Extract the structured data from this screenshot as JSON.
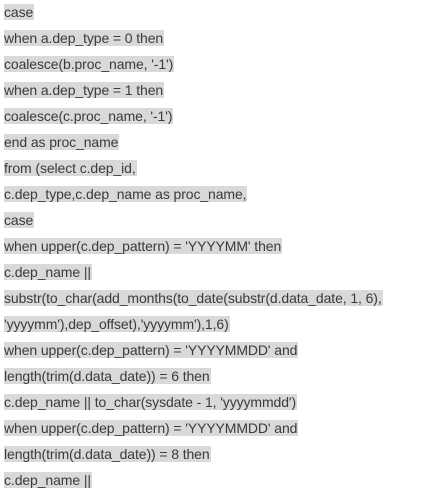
{
  "document": {
    "lines": [
      "case",
      "when a.dep_type = 0 then",
      "coalesce(b.proc_name, '-1')",
      "when a.dep_type = 1 then",
      "coalesce(c.proc_name, '-1')",
      "end as proc_name",
      "from (select c.dep_id,",
      "c.dep_type,c.dep_name as proc_name,",
      "case",
      "when upper(c.dep_pattern) = 'YYYYMM' then",
      "c.dep_name ||",
      "substr(to_char(add_months(to_date(substr(d.data_date, 1, 6),",
      "'yyyymm'),dep_offset),'yyyymm'),1,6)",
      "when upper(c.dep_pattern) = 'YYYYMMDD' and",
      "length(trim(d.data_date)) = 6 then",
      "c.dep_name || to_char(sysdate - 1, 'yyyymmdd')",
      "when upper(c.dep_pattern) = 'YYYYMMDD' and",
      "length(trim(d.data_date)) = 8 then",
      "c.dep_name ||"
    ]
  },
  "colors": {
    "highlight": "#d9d9d9",
    "text": "#3b3b3b",
    "background": "#ffffff"
  }
}
